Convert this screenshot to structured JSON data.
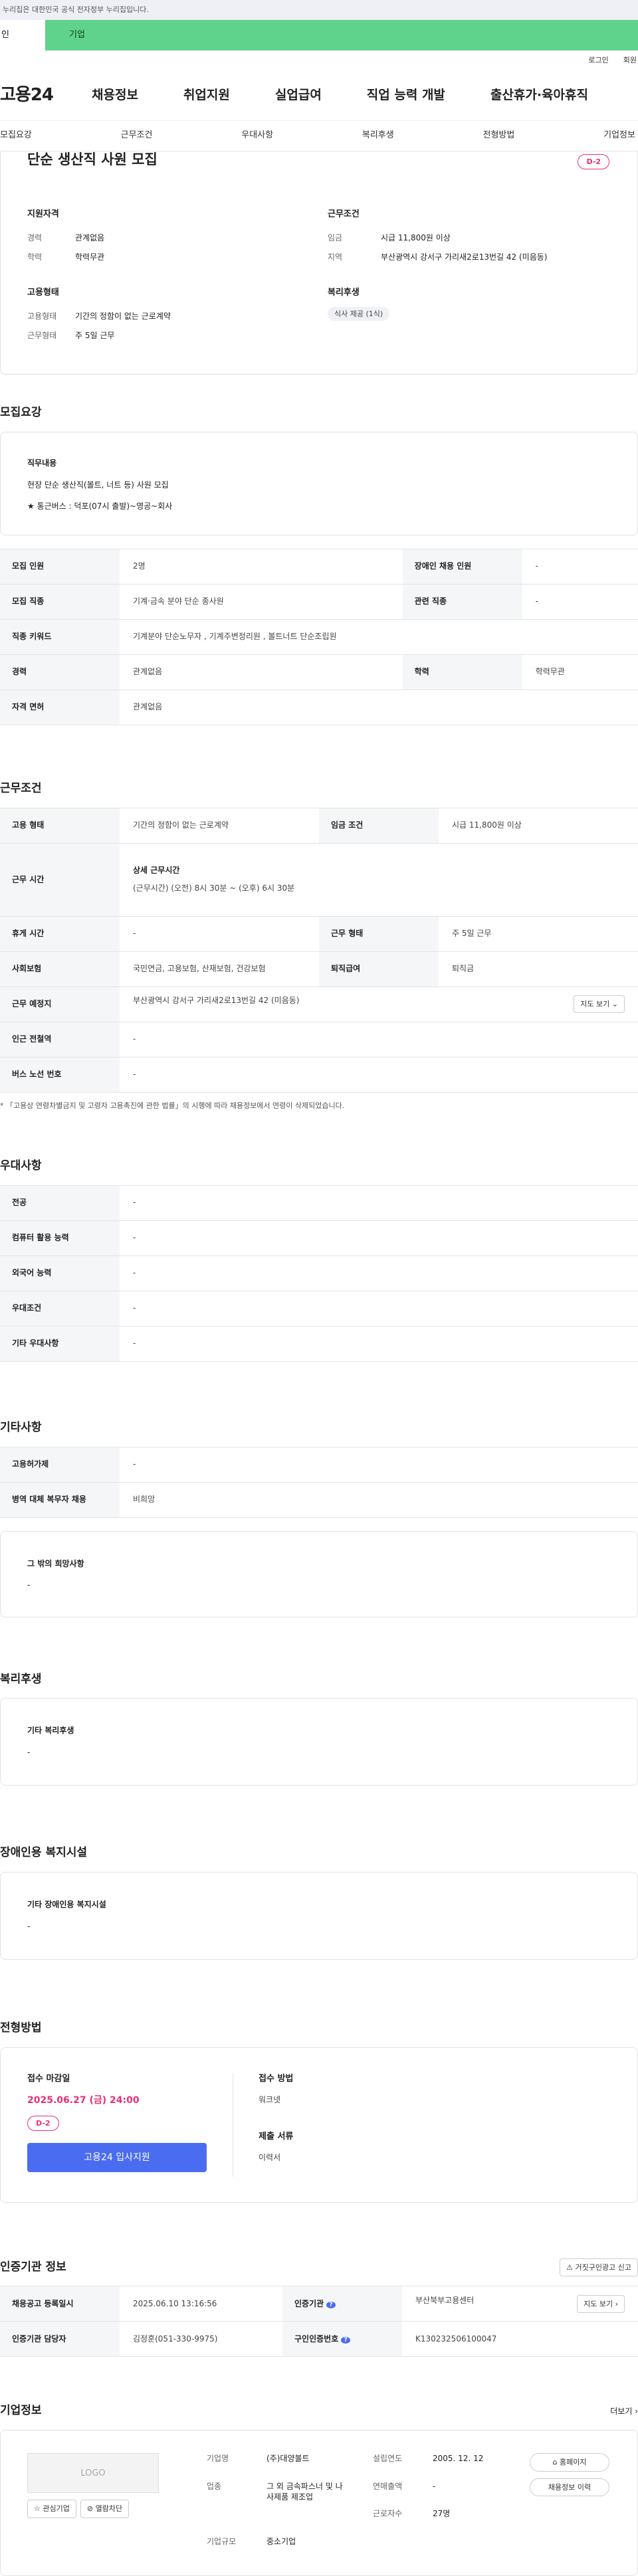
{
  "gov_notice": "이 누리집은 대한민국 공식 전자정부 누리집입니다.",
  "gov_notice_visible": "누리집은 대한민국 공식 전자정부 누리집입니다.",
  "top_tabs": [
    "개인",
    "기업"
  ],
  "top_tab_visible": "인",
  "util": [
    "로그인",
    "회원가입"
  ],
  "util_visible": [
    "로그인",
    "회원"
  ],
  "logo": "고용24",
  "main_nav": [
    "채용정보",
    "취업지원",
    "실업급여",
    "직업 능력 개발",
    "출산휴가·육아휴직"
  ],
  "sub_nav": [
    "모집요강",
    "근무조건",
    "우대사항",
    "복리후생",
    "전형방법",
    "기업정보"
  ],
  "summary": {
    "title": "단순 생산직 사원 모집",
    "dday": "D-2",
    "req_h": "지원자격",
    "req": [
      [
        "경력",
        "관계없음"
      ],
      [
        "학력",
        "학력무관"
      ]
    ],
    "emp_h": "고용형태",
    "emp": [
      [
        "고용형태",
        "기간의 정함이 없는 근로계약"
      ],
      [
        "근무형태",
        "주 5일 근무"
      ]
    ],
    "cond_h": "근무조건",
    "cond": [
      [
        "임금",
        "시급 11,800원 이상"
      ],
      [
        "지역",
        "부산광역시 강서구 가리새2로13번길 42 (미음동)"
      ]
    ],
    "welfare_h": "복리후생",
    "welfare_tag": "식사 제공 (1식)"
  },
  "recruit": {
    "title": "모집요강",
    "duty_label": "직무내용",
    "duty1": "현장 단순 생산직(볼트, 너트 등) 사원 모집",
    "duty2": "★ 통근버스 : 덕포(07시 출발)~영공~회사",
    "r1": [
      "모집 인원",
      "2명",
      "장애인 채용 인원",
      "-"
    ],
    "r2": [
      "모집 직종",
      "기계·금속 분야 단순 종사원",
      "관련 직종",
      "-"
    ],
    "r3": [
      "직종 키워드",
      "기계분야 단순노무자 , 기계주변정리원 , 볼트너트 단순조립원"
    ],
    "r4": [
      "경력",
      "관계없음",
      "학력",
      "학력무관"
    ],
    "r5": [
      "자격 면허",
      "관계없음"
    ]
  },
  "work": {
    "title": "근무조건",
    "r1": [
      "고용 형태",
      "기간의 정함이 없는 근로계약",
      "임금 조건",
      "시급 11,800원 이상"
    ],
    "hours_h": "근무 시간",
    "hours_t": "상세 근무시간",
    "hours_v": "(근무시간) (오전) 8시 30분 ~ (오후) 6시 30분",
    "r3": [
      "휴게 시간",
      "-",
      "근무 형태",
      "주 5일 근무"
    ],
    "r4": [
      "사회보험",
      "국민연금, 고용보험, 산재보험, 건강보험",
      "퇴직급여",
      "퇴직금"
    ],
    "r5": [
      "근무 예정지",
      "부산광역시 강서구 가리새2로13번길 42 (미음동)"
    ],
    "map_btn": "지도 보기",
    "r6": [
      "인근 전철역",
      "-"
    ],
    "r7": [
      "버스 노선 번호",
      "-"
    ],
    "note": "* 「고용상 연령차별금지 및 고령자 고용촉진에 관한 법률」의 시행에 따라 채용정보에서 연령이 삭제되었습니다."
  },
  "pref": {
    "title": "우대사항",
    "rows": [
      [
        "전공",
        "-"
      ],
      [
        "컴퓨터 활용 능력",
        "-"
      ],
      [
        "외국어 능력",
        "-"
      ],
      [
        "우대조건",
        "-"
      ],
      [
        "기타 우대사항",
        "-"
      ]
    ]
  },
  "etc": {
    "title": "기타사항",
    "rows": [
      [
        "고용허가제",
        "-"
      ],
      [
        "병역 대체 복무자 채용",
        "비희망"
      ]
    ],
    "hope_label": "그 밖의 희망사항",
    "hope_val": "-"
  },
  "welfare": {
    "title": "복리후생",
    "label": "기타 복리후생",
    "val": "-"
  },
  "disab": {
    "title": "장애인용 복지시설",
    "label": "기타 장애인용 복지시설",
    "val": "-"
  },
  "selection": {
    "title": "전형방법",
    "deadline_label": "접수 마감일",
    "deadline": "2025.06.27 (금) 24:00",
    "dday": "D-2",
    "apply_btn": "고용24 입사지원",
    "method_label": "접수 방법",
    "method": "워크넷",
    "docs_label": "제출 서류",
    "docs": "이력서"
  },
  "cert": {
    "title": "인증기관 정보",
    "report_btn": "거짓구인광고 신고",
    "rows": [
      [
        "채용공고 등록일시",
        "2025.06.10 13:16:56",
        "인증기관",
        "부산북부고용센터"
      ],
      [
        "인증기관 담당자",
        "김정훈(051-330-9975)",
        "구인인증번호",
        "K130232506100047"
      ]
    ],
    "map_btn": "지도 보기"
  },
  "company": {
    "title": "기업정보",
    "more": "더보기",
    "logo_text": "LOGO",
    "fav_btn": "관심기업",
    "block_btn": "열람차단",
    "rows": [
      [
        "기업명",
        "(주)대양볼트",
        "설립연도",
        "2005. 12. 12"
      ],
      [
        "업종",
        "그 외 금속파스너 및 나사제품 제조업",
        "연매출액",
        "-"
      ],
      [
        "",
        "",
        "근로자수",
        "27명"
      ],
      [
        "기업규모",
        "중소기업",
        "",
        ""
      ]
    ],
    "home_btn": "홈페이지",
    "jobs_btn": "채용정보 이력"
  }
}
